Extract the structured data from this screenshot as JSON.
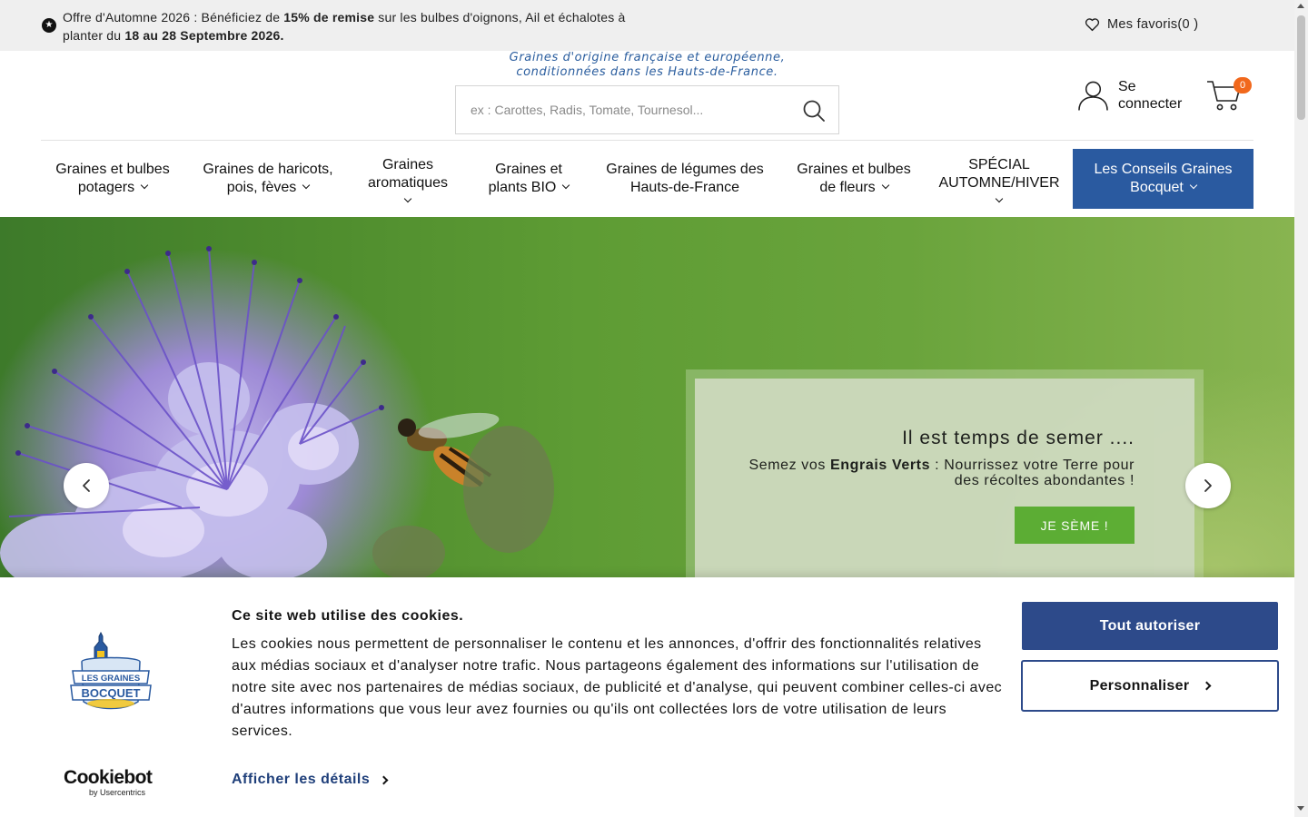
{
  "promo": {
    "icon": "star-badge-icon",
    "text_part1": "Offre d'Automne 2026 : Bénéficiez de ",
    "text_bold1": "15% de remise",
    "text_part2": " sur les bulbes d'oignons, Ail et échalotes à planter du ",
    "text_bold2": "18 au 28 Septembre 2026.",
    "favorites_label": "Mes favoris(0 )"
  },
  "header": {
    "tagline_line1": "Graines d'origine française et européenne,",
    "tagline_line2": "conditionnées dans les Hauts-de-France.",
    "search_placeholder": "ex : Carottes, Radis, Tomate, Tournesol...",
    "search_value": "",
    "account_label": "Se connecter",
    "cart_count": "0"
  },
  "nav": {
    "items": [
      {
        "label": "Graines et bulbes potagers",
        "has_dropdown": true
      },
      {
        "label": "Graines de haricots, pois, fèves",
        "has_dropdown": true
      },
      {
        "label": "Graines aromatiques",
        "has_dropdown": true
      },
      {
        "label": "Graines et plants BIO",
        "has_dropdown": true
      },
      {
        "label": "Graines de légumes des Hauts-de-France",
        "has_dropdown": false
      },
      {
        "label": "Graines et bulbes de fleurs",
        "has_dropdown": true
      },
      {
        "label": "SPÉCIAL AUTOMNE/HIVER",
        "has_dropdown": true
      },
      {
        "label": "Les Conseils Graines Bocquet",
        "has_dropdown": true
      }
    ],
    "highlight_color": "#2a5aa0"
  },
  "hero": {
    "title": "Il est temps de semer ....",
    "subtitle_part1": "Semez vos ",
    "subtitle_bold": "Engrais Verts",
    "subtitle_part2": " : Nourrissez votre Terre pour des récoltes abondantes !",
    "cta_label": "JE SÈME !",
    "cta_color": "#5aad32"
  },
  "cookie": {
    "title": "Ce site web utilise des cookies.",
    "text": "Les cookies nous permettent de personnaliser le contenu et les annonces, d'offrir des fonctionnalités relatives aux médias sociaux et d'analyser notre trafic. Nous partageons également des informations sur l'utilisation de notre site avec nos partenaires de médias sociaux, de publicité et d'analyse, qui peuvent combiner celles-ci avec d'autres informations que vous leur avez fournies ou qu'ils ont collectées lors de votre utilisation de leurs services.",
    "details_label": "Afficher les détails",
    "allow_label": "Tout autoriser",
    "customize_label": "Personnaliser",
    "brand_name": "Cookiebot",
    "brand_by": "by Usercentrics",
    "logo_text_line1": "LES GRAINES",
    "logo_text_line2": "BOCQUET",
    "primary_color": "#2d4a8a"
  }
}
